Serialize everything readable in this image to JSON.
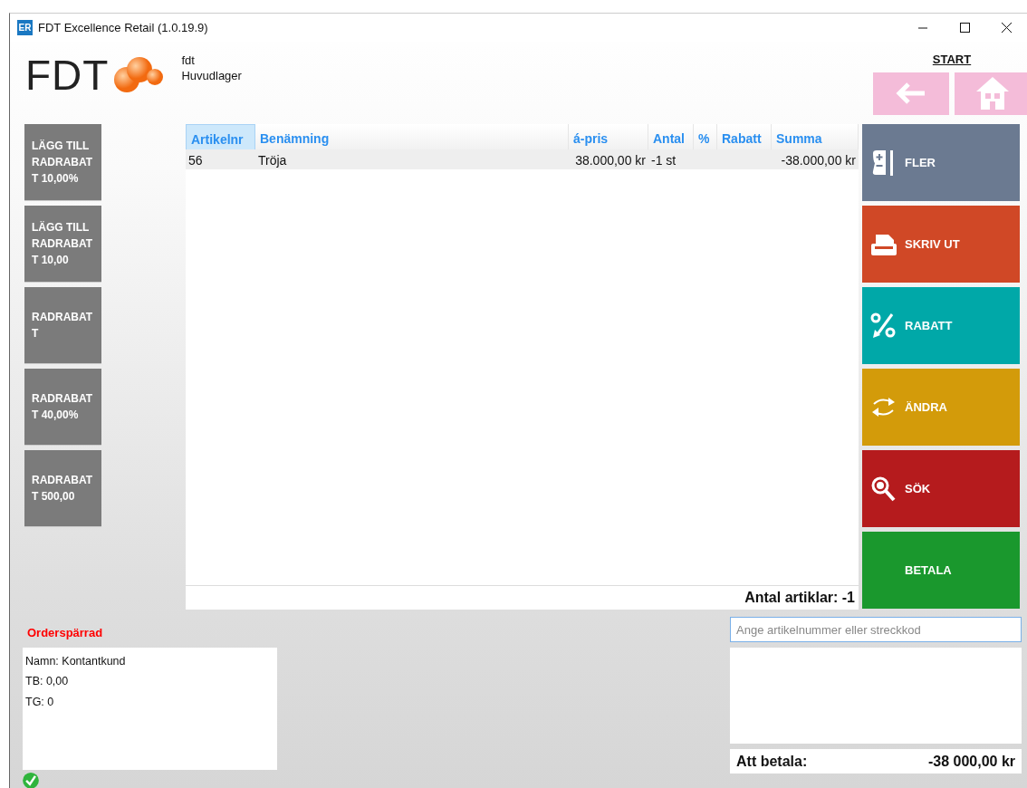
{
  "window": {
    "title": "FDT Excellence Retail (1.0.19.9)",
    "app_badge": "ER"
  },
  "header": {
    "logo_text": "FDT",
    "company": "fdt",
    "warehouse": "Huvudlager"
  },
  "nav": {
    "start_label": "START"
  },
  "left_buttons": [
    {
      "label": "LÄGG TILL RADRABATT 10,00%"
    },
    {
      "label": "LÄGG TILL RADRABATT 10,00"
    },
    {
      "label": "RADRABATT"
    },
    {
      "label": "RADRABATT 40,00%"
    },
    {
      "label": "RADRABATT 500,00"
    }
  ],
  "table": {
    "columns": [
      {
        "label": "Artikelnr",
        "selected": true
      },
      {
        "label": "Benämning",
        "selected": false
      },
      {
        "label": "á-pris",
        "selected": false
      },
      {
        "label": "Antal",
        "selected": false
      },
      {
        "label": "%",
        "selected": false
      },
      {
        "label": "Rabatt",
        "selected": false
      },
      {
        "label": "Summa",
        "selected": false
      }
    ],
    "rows": [
      {
        "selected": true,
        "cells": [
          "56",
          "Tröja",
          "38.000,00 kr",
          "-1 st",
          "",
          "",
          "-38.000,00 kr"
        ]
      }
    ],
    "footer": "Antal artiklar: -1"
  },
  "action_buttons": [
    {
      "label": "FLER",
      "color": "#6b7a91"
    },
    {
      "label": "SKRIV UT",
      "color": "#d04826"
    },
    {
      "label": "RABATT",
      "color": "#00a8a8"
    },
    {
      "label": "ÄNDRA",
      "color": "#d39b0a"
    },
    {
      "label": "SÖK",
      "color": "#b51b1d"
    },
    {
      "label": "BETALA",
      "color": "#1a982d"
    }
  ],
  "order_status": "Orderspärrad",
  "customer_info": [
    "Namn: Kontantkund",
    "TB: 0,00",
    "TG: 0"
  ],
  "article_input": {
    "placeholder": "Ange artikelnummer eller streckkod"
  },
  "total": {
    "label": "Att betala:",
    "value": "-38 000,00 kr"
  }
}
